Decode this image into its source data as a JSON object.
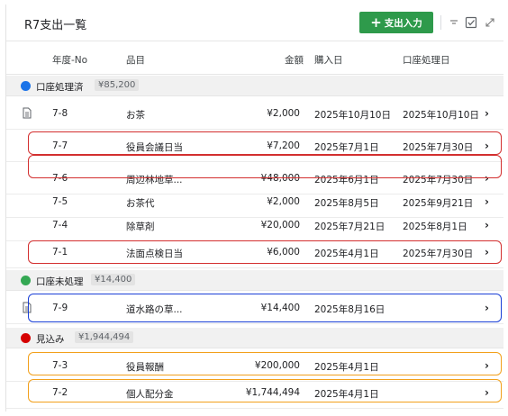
{
  "header": {
    "title": "R7支出一覧",
    "add_button": "支出入力"
  },
  "columns": {
    "year_no": "年度-No",
    "item": "品目",
    "amount": "金額",
    "purchase_date": "購入日",
    "account_date": "口座処理日"
  },
  "groups": [
    {
      "label": "口座処理済",
      "total": "¥85,200",
      "color": "#1a73e8"
    },
    {
      "label": "口座未処理",
      "total": "¥14,400",
      "color": "#34a853"
    },
    {
      "label": "見込み",
      "total": "¥1,944,494",
      "color": "#d50000"
    }
  ],
  "rows": [
    {
      "no": "7-8",
      "item": "お茶",
      "amount": "¥2,000",
      "purchase": "2025年10月10日",
      "account": "2025年10月10日",
      "doc": true
    },
    {
      "no": "7-7",
      "item": "役員会議日当",
      "amount": "¥7,200",
      "purchase": "2025年7月1日",
      "account": "2025年7月30日",
      "highlight": "#d32f2f"
    },
    {
      "no": "7-6",
      "item": "周辺林地草...",
      "amount": "¥48,000",
      "purchase": "2025年6月1日",
      "account": "2025年7月30日",
      "highlight": "#d32f2f"
    },
    {
      "no": "7-5",
      "item": "お茶代",
      "amount": "¥2,000",
      "purchase": "2025年8月5日",
      "account": "2025年9月21日"
    },
    {
      "no": "7-4",
      "item": "除草剤",
      "amount": "¥20,000",
      "purchase": "2025年7月21日",
      "account": "2025年8月1日"
    },
    {
      "no": "7-1",
      "item": "法面点検日当",
      "amount": "¥6,000",
      "purchase": "2025年4月1日",
      "account": "2025年7月30日",
      "highlight": "#d32f2f"
    },
    {
      "no": "7-9",
      "item": "道水路の草...",
      "amount": "¥14,400",
      "purchase": "2025年8月16日",
      "account": "",
      "doc": true,
      "highlight": "#1a3fd6"
    },
    {
      "no": "7-3",
      "item": "役員報酬",
      "amount": "¥200,000",
      "purchase": "2025年4月1日",
      "account": "",
      "highlight": "#f2a01b"
    },
    {
      "no": "7-2",
      "item": "個人配分金",
      "amount": "¥1,744,494",
      "purchase": "2025年4月1日",
      "account": "",
      "highlight": "#f2a01b"
    }
  ]
}
